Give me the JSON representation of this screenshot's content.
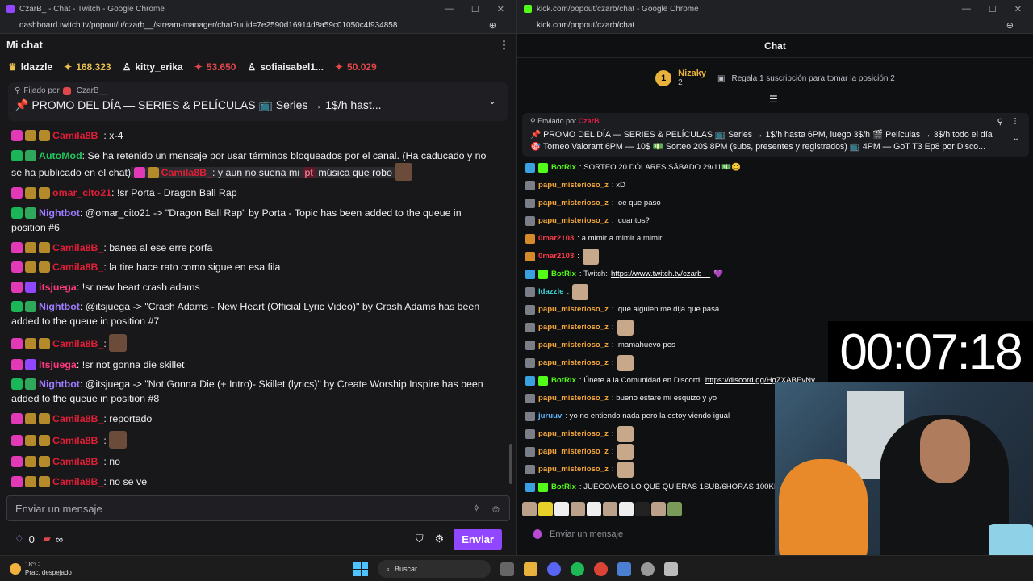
{
  "left_window": {
    "title": "CzarB_ - Chat - Twitch - Google Chrome",
    "url": "dashboard.twitch.tv/popout/u/czarb__/stream-manager/chat?uuid=7e2590d16914d8a59c01050c4f934858",
    "header": "Mi chat",
    "leaderboard": [
      {
        "name": "ldazzle",
        "style": "gold"
      },
      {
        "name": "168.323",
        "style": "gold-value"
      },
      {
        "name": "kitty_erika",
        "style": "white"
      },
      {
        "name": "53.650",
        "style": "red-value"
      },
      {
        "name": "sofiaisabel1...",
        "style": "white"
      },
      {
        "name": "50.029",
        "style": "red-value"
      }
    ],
    "pinned": {
      "by_label": "Fijado por",
      "by_user": "CzarB__",
      "message": "📌 PROMO DEL DÍA — SERIES & PELÍCULAS 📺 Series → 1$/h hast..."
    },
    "messages": [
      {
        "user": "Camila8B_",
        "text": ": x-4",
        "color": "red"
      },
      {
        "user": "AutoMod",
        "text": ": Se ha retenido un mensaje por usar términos bloqueados por el canal. (Ha caducado y no se ha publicado en el chat)",
        "color": "green",
        "held_user": "Camila8B_",
        "held_text": ": y aun no suena mi",
        "held_tag": "pt",
        "held_text2": "música que robo"
      },
      {
        "user": "omar_cito21",
        "text": ": !sr Porta - Dragon Ball Rap",
        "color": "red"
      },
      {
        "user": "Nightbot",
        "text": ": @omar_cito21 -> \"Dragon Ball Rap\" by Porta - Topic has been added to the queue in position #6",
        "color": "purple"
      },
      {
        "user": "Camila8B_",
        "text": ": banea al ese erre porfa",
        "color": "red"
      },
      {
        "user": "Camila8B_",
        "text": ": la tire hace rato como sigue en esa fila",
        "color": "red"
      },
      {
        "user": "itsjuega",
        "text": ": !sr new heart crash adams",
        "color": "pink"
      },
      {
        "user": "Nightbot",
        "text": ": @itsjuega -> \"Crash Adams - New Heart (Official Lyric Video)\" by Crash Adams has been added to the queue in position #7",
        "color": "purple"
      },
      {
        "user": "Camila8B_",
        "text": ":",
        "color": "red",
        "emote": true
      },
      {
        "user": "itsjuega",
        "text": ": !sr not gonna die skillet",
        "color": "pink"
      },
      {
        "user": "Nightbot",
        "text": ": @itsjuega -> \"Not Gonna Die (+ Intro)- Skillet (lyrics)\" by Create Worship Inspire has been added to the queue in position #8",
        "color": "purple"
      },
      {
        "user": "Camila8B_",
        "text": ": reportado",
        "color": "red"
      },
      {
        "user": "Camila8B_",
        "text": ":",
        "color": "red",
        "emote": true
      },
      {
        "user": "Camila8B_",
        "text": ": no",
        "color": "red"
      },
      {
        "user": "Camila8B_",
        "text": ": no se ve",
        "color": "red"
      }
    ],
    "input_placeholder": "Enviar un mensaje",
    "points": "0",
    "infinity": "∞",
    "send_label": "Enviar"
  },
  "right_window": {
    "title": "kick.com/popout/czarb/chat - Google Chrome",
    "url": "kick.com/popout/czarb/chat",
    "header": "Chat",
    "top_gifter": {
      "position": "1",
      "name": "Nizaky",
      "count": "2",
      "cta": "Regala 1 suscripción para tomar la posición 2"
    },
    "pinned": {
      "by_label": "Enviado por",
      "by_user": "CzarB",
      "line1": "📌 PROMO DEL DÍA — SERIES & PELÍCULAS 📺 Series → 1$/h hasta 6PM, luego 3$/h 🎬 Películas → 3$/h todo el día",
      "line2": "🎯 Torneo Valorant 6PM — 10$ 💵 Sorteo 20$ 8PM (subs, presentes y registrados) 📺 4PM — GoT T3 Ep8 por Disco..."
    },
    "messages": [
      {
        "user": "BotRix",
        "text": ": SORTEO 20 DÓLARES SÁBADO 29/11💵😊",
        "color": "green"
      },
      {
        "user": "papu_misterioso_z",
        "text": ": xD",
        "color": "orange"
      },
      {
        "user": "papu_misterioso_z",
        "text": ": .oe que paso",
        "color": "orange"
      },
      {
        "user": "papu_misterioso_z",
        "text": ": .cuantos?",
        "color": "orange"
      },
      {
        "user": "0mar2103",
        "text": ": a mimir a mimir a mimir",
        "color": "red"
      },
      {
        "user": "0mar2103",
        "text": ":",
        "color": "red",
        "emote": true
      },
      {
        "user": "BotRix",
        "text": ": Twitch: ",
        "color": "green",
        "link": "https://www.twitch.tv/czarb__",
        "after": " 💜"
      },
      {
        "user": "ldazzle",
        "text": ":",
        "color": "cyan",
        "emote": true
      },
      {
        "user": "papu_misterioso_z",
        "text": ": .que alguien me dija que pasa",
        "color": "orange"
      },
      {
        "user": "papu_misterioso_z",
        "text": ":",
        "color": "orange",
        "emote": true
      },
      {
        "user": "papu_misterioso_z",
        "text": ": .mamahuevo pes",
        "color": "orange"
      },
      {
        "user": "papu_misterioso_z",
        "text": ":",
        "color": "orange",
        "emote": true
      },
      {
        "user": "BotRix",
        "text": ": Únete a la Comunidad en Discord: ",
        "color": "green",
        "link": "https://discord.gg/HgZXABEvNy"
      },
      {
        "user": "papu_misterioso_z",
        "text": ": bueno estare mi esquizo y yo",
        "color": "orange"
      },
      {
        "user": "juruuv",
        "text": ": yo no entiendo nada pero la estoy viendo igual",
        "color": "blue"
      },
      {
        "user": "papu_misterioso_z",
        "text": ":",
        "color": "orange",
        "emote": true
      },
      {
        "user": "papu_misterioso_z",
        "text": ":",
        "color": "orange",
        "emote": true
      },
      {
        "user": "papu_misterioso_z",
        "text": ":",
        "color": "orange",
        "emote": true
      },
      {
        "user": "BotRix",
        "text": ": JUEGO/VEO LO QUE QUIERAS 1SUB/6HORAS 100KICKS",
        "color": "green"
      }
    ],
    "input_placeholder": "Enviar un mensaje"
  },
  "overlay": {
    "timer": "00:07:18"
  },
  "taskbar": {
    "temp": "18°C",
    "weather": "Prac. despejado",
    "search": "Buscar"
  }
}
